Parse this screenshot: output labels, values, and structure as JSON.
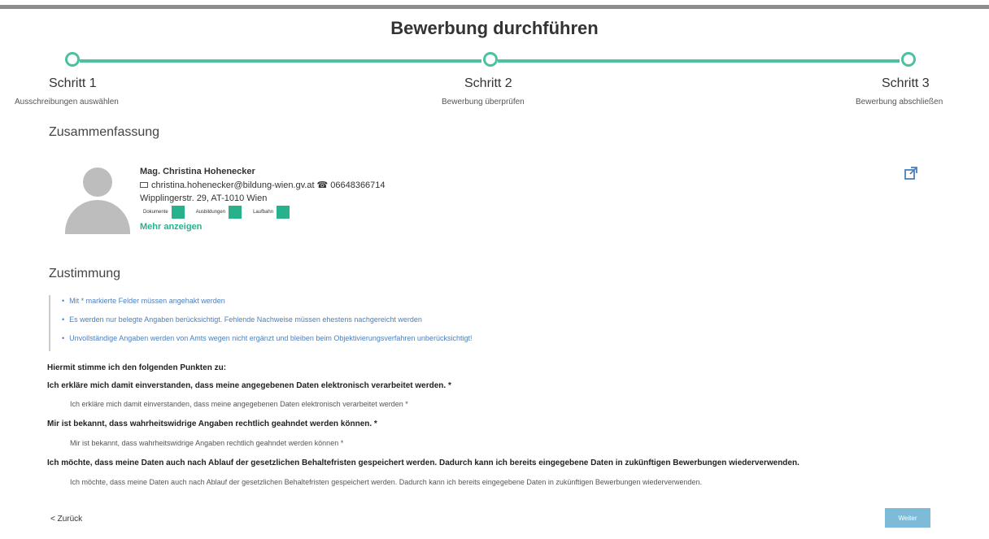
{
  "title": "Bewerbung durchführen",
  "steps": [
    {
      "title": "Schritt 1",
      "subtitle": "Ausschreibungen auswählen"
    },
    {
      "title": "Schritt 2",
      "subtitle": "Bewerbung überprüfen"
    },
    {
      "title": "Schritt 3",
      "subtitle": "Bewerbung abschließen"
    }
  ],
  "summary": {
    "heading": "Zusammenfassung",
    "name": "Mag. Christina Hohenecker",
    "email": "christina.hohenecker@bildung-wien.gv.at",
    "phone": "06648366714",
    "address": "Wipplingerstr. 29, AT-1010 Wien",
    "badges": [
      "Dokumente",
      "Ausbildungen",
      "Laufbahn"
    ],
    "more_label": "Mehr anzeigen",
    "edit_icon": "external-link-icon"
  },
  "consent": {
    "heading": "Zustimmung",
    "notes": [
      "Mit * markierte Felder müssen angehakt werden",
      "Es werden nur belegte Angaben berücksichtigt. Fehlende Nachweise müssen ehestens nachgereicht werden",
      "Unvollständige Angaben werden von Amts wegen nicht ergänzt und bleiben beim Objektivierungsverfahren unberücksichtigt!"
    ],
    "intro": "Hiermit stimme ich den folgenden Punkten zu:",
    "items": [
      {
        "title": "Ich erkläre mich damit einverstanden, dass meine angegebenen Daten elektronisch verarbeitet werden. *",
        "text": "Ich erkläre mich damit einverstanden, dass meine angegebenen Daten elektronisch verarbeitet werden  *"
      },
      {
        "title": "Mir ist bekannt, dass wahrheitswidrige Angaben rechtlich geahndet werden können. *",
        "text": "Mir ist bekannt, dass wahrheitswidrige Angaben rechtlich geahndet werden können  *"
      },
      {
        "title": "Ich möchte, dass meine Daten auch nach Ablauf der gesetzlichen Behaltefristen gespeichert werden. Dadurch kann ich bereits eingegebene Daten in zukünftigen Bewerbungen wiederverwenden.",
        "text": "Ich möchte, dass meine Daten auch nach Ablauf der gesetzlichen Behaltefristen gespeichert werden. Dadurch kann ich bereits eingegebene Daten in zukünftigen Bewerbungen wiederverwenden."
      }
    ]
  },
  "nav": {
    "back_label": "< Zurück",
    "next_label": "Weiter"
  },
  "colors": {
    "accent": "#4cc0a0",
    "badge": "#27b28d",
    "info_text": "#4b7fbd",
    "button": "#7dbbd8"
  }
}
